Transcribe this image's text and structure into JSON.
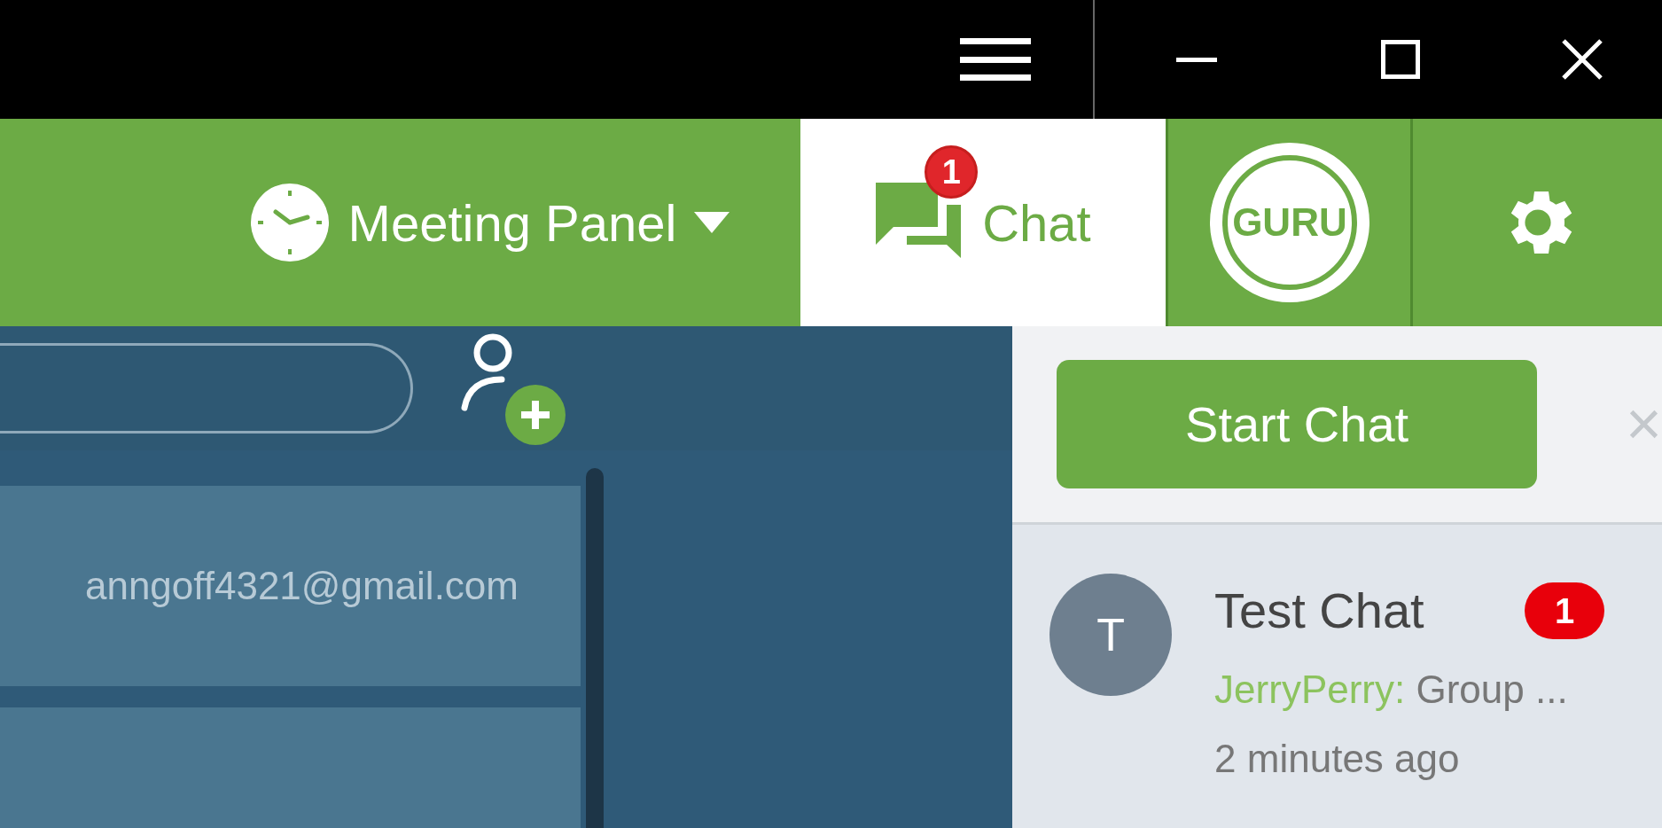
{
  "header": {
    "meeting_panel": {
      "label": "Meeting Panel"
    },
    "tabs": [
      {
        "kind": "chat",
        "label": "Chat",
        "badge": "1",
        "selected": true
      }
    ],
    "logo": {
      "text": "GURU"
    }
  },
  "contacts": {
    "items": [
      {
        "email": "anngoff4321@gmail.com"
      }
    ]
  },
  "chat_panel": {
    "start_button": "Start Chat",
    "close": "×",
    "chats": [
      {
        "initial": "T",
        "name": "Test Chat",
        "unread": "1",
        "sender": "JerryPerry:",
        "preview": " Group ...",
        "time": "2 minutes ago"
      }
    ]
  }
}
